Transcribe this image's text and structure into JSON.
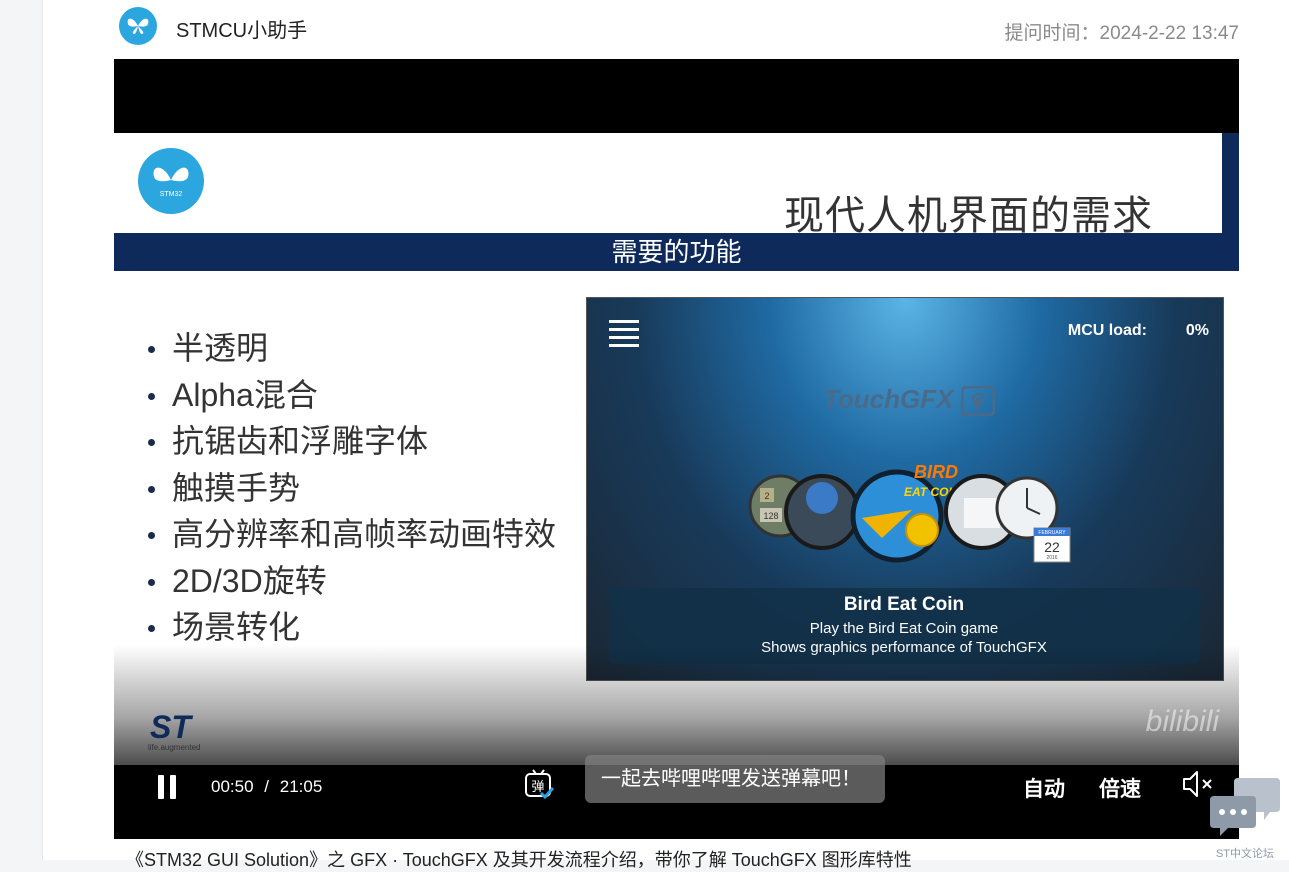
{
  "post": {
    "author": "STMCU小助手",
    "time_label": "提问时间：2024-2-22 13:47",
    "caption": "《STM32 GUI Solution》之 GFX · TouchGFX 及其开发流程介绍，带你了解 TouchGFX 图形库特性"
  },
  "slide": {
    "logo_text": "STM32",
    "title": "现代人机界面的需求",
    "bar_text": "需要的功能",
    "bullets": [
      "半透明",
      "Alpha混合",
      "抗锯齿和浮雕字体",
      "触摸手势",
      "高分辨率和高帧率动画特效",
      "2D/3D旋转",
      "场景转化"
    ],
    "footer_logo": "ST",
    "footer_tagline": "life.augmented",
    "watermark": "bilibili"
  },
  "demo": {
    "mcu_load_label": "MCU load:",
    "mcu_load_value": "0%",
    "brand": "TouchGFX",
    "calendar_month": "FEBRUARY",
    "calendar_day": "22",
    "calendar_year": "2016",
    "tile_left_1": "2",
    "tile_left_2": "128",
    "bird_logo_line1": "BIRD",
    "bird_logo_line2": "EAT COIN",
    "info_title": "Bird Eat Coin",
    "info_line1": "Play the Bird Eat Coin game",
    "info_line2": "Shows graphics performance of TouchGFX"
  },
  "player": {
    "current_time": "00:50",
    "separator": "/",
    "duration": "21:05",
    "danmaku_icon_text": "弹",
    "danmaku_placeholder": "一起去哔哩哔哩发送弹幕吧！",
    "auto_label": "自动",
    "speed_label": "倍速"
  },
  "widget": {
    "label": "ST中文论坛"
  },
  "colors": {
    "brand_blue": "#2ba6de",
    "slide_navy": "#0d2a5a"
  }
}
